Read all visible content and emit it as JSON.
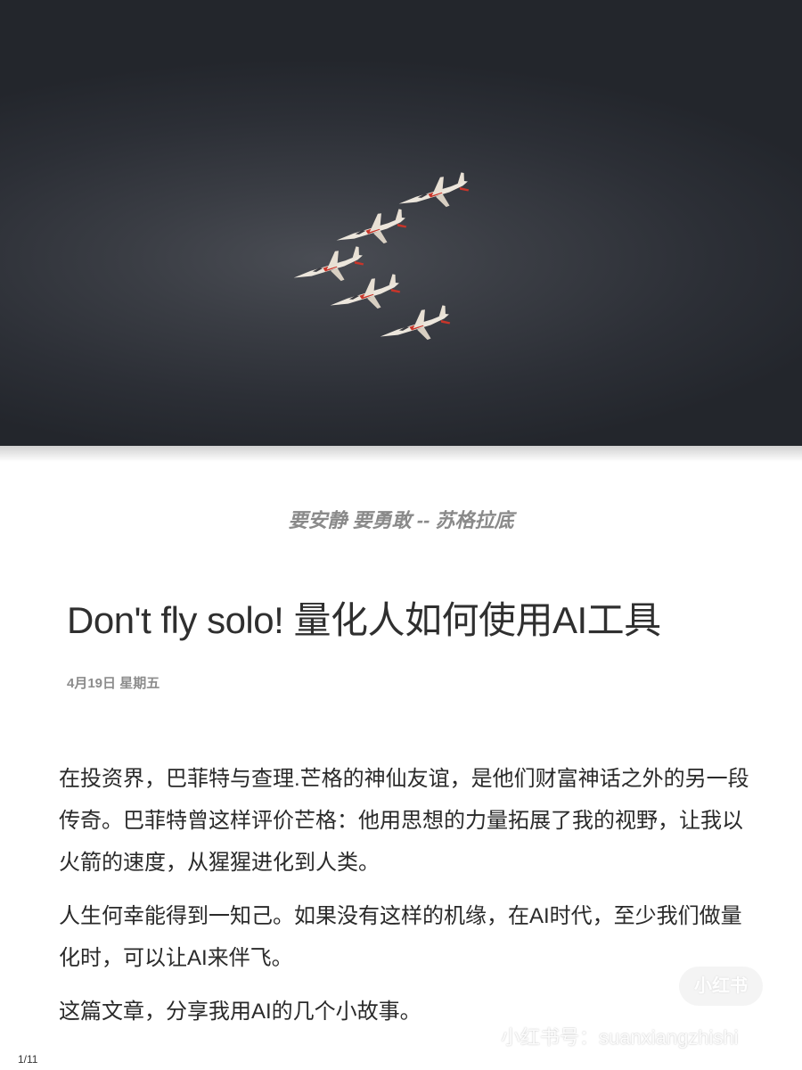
{
  "hero": {
    "jet_count": 5
  },
  "quote": "要安静 要勇敢 -- 苏格拉底",
  "title": "Don't fly solo! 量化人如何使用AI工具",
  "date": "4月19日 星期五",
  "paragraphs": [
    "在投资界，巴菲特与查理.芒格的神仙友谊，是他们财富神话之外的另一段传奇。巴菲特曾这样评价芒格：他用思想的力量拓展了我的视野，让我以火箭的速度，从猩猩进化到人类。",
    "人生何幸能得到一知己。如果没有这样的机缘，在AI时代，至少我们做量化时，可以让AI来伴飞。",
    "这篇文章，分享我用AI的几个小故事。"
  ],
  "watermark": {
    "badge": "小红书",
    "account": "小红书号：suanxiangzhishi"
  },
  "page_indicator": "1/11"
}
